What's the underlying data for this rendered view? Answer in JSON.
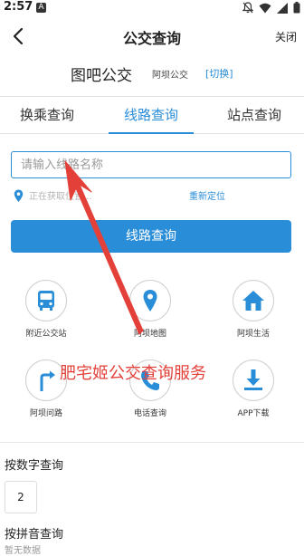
{
  "status_bar": {
    "time": "2:57",
    "notice_glyph": "A",
    "icons": [
      "bell-off-icon",
      "wifi-icon",
      "signal-icon",
      "battery-icon"
    ]
  },
  "header": {
    "title": "公交查询",
    "close_label": "关闭",
    "back_icon": "chevron-left-icon"
  },
  "brand": {
    "app_name": "图吧公交",
    "city": "阿坝公交",
    "switch_label": "[切换]"
  },
  "tabs": [
    {
      "label": "换乘查询",
      "active": false
    },
    {
      "label": "线路查询",
      "active": true
    },
    {
      "label": "站点查询",
      "active": false
    }
  ],
  "search": {
    "placeholder": "请输入线路名称",
    "value": ""
  },
  "location": {
    "status": "正在获取位置...",
    "relocate_label": "重新定位"
  },
  "primary_button": {
    "label": "线路查询"
  },
  "grid": [
    {
      "label": "附近公交站",
      "icon": "bus-icon"
    },
    {
      "label": "阿坝地图",
      "icon": "map-pin-icon"
    },
    {
      "label": "阿坝生活",
      "icon": "home-icon"
    },
    {
      "label": "阿坝问路",
      "icon": "direction-sign-icon"
    },
    {
      "label": "电话查询",
      "icon": "phone-icon"
    },
    {
      "label": "APP下载",
      "icon": "download-icon"
    }
  ],
  "sections": {
    "number_title": "按数字查询",
    "number_buttons": [
      "2"
    ],
    "pinyin_title": "按拼音查询",
    "pinyin_cutoff": "暂无数据"
  },
  "annotation": {
    "text": "肥宅姬公交查询服务"
  },
  "colors": {
    "accent": "#2a8dd8",
    "annotation": "#e3403a"
  }
}
